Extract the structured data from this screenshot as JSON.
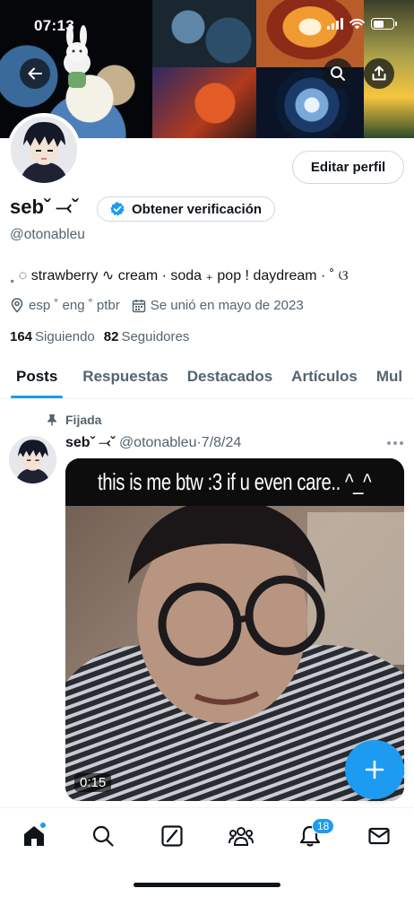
{
  "status_bar": {
    "time": "07:13"
  },
  "profile": {
    "name": "sebˇ ⤙ˇ",
    "handle": "@otonableu",
    "edit_label": "Editar perfil",
    "verify_label": "Obtener verificación",
    "bio": "˳ ◌ strawberry ∿ cream · soda ₊ pop ! daydream · ˚ ଓ",
    "languages": "esp ˚ eng ˚ ptbr",
    "joined": "Se unió en mayo de 2023",
    "following_count": "164",
    "following_label": "Siguiendo",
    "followers_count": "82",
    "followers_label": "Seguidores"
  },
  "tabs": [
    {
      "label": "Posts",
      "active": true
    },
    {
      "label": "Respuestas",
      "active": false
    },
    {
      "label": "Destacados",
      "active": false
    },
    {
      "label": "Artículos",
      "active": false
    },
    {
      "label": "Mul",
      "active": false
    }
  ],
  "post": {
    "pinned_label": "Fijada",
    "name": "sebˇ ⤙ˇ",
    "handle": "@otonableu",
    "separator": "·",
    "date": "7/8/24",
    "media_caption": "this is me btw :3 if u even care.. ^_^",
    "duration": "0:15"
  },
  "nav": {
    "notifications_badge": "18",
    "items": [
      "home-icon",
      "search-icon",
      "grok-icon",
      "communities-icon",
      "notifications-icon",
      "messages-icon"
    ]
  },
  "colors": {
    "accent": "#1d9bf0",
    "text_primary": "#0f1419",
    "text_secondary": "#536471",
    "border": "#cfd9de"
  }
}
